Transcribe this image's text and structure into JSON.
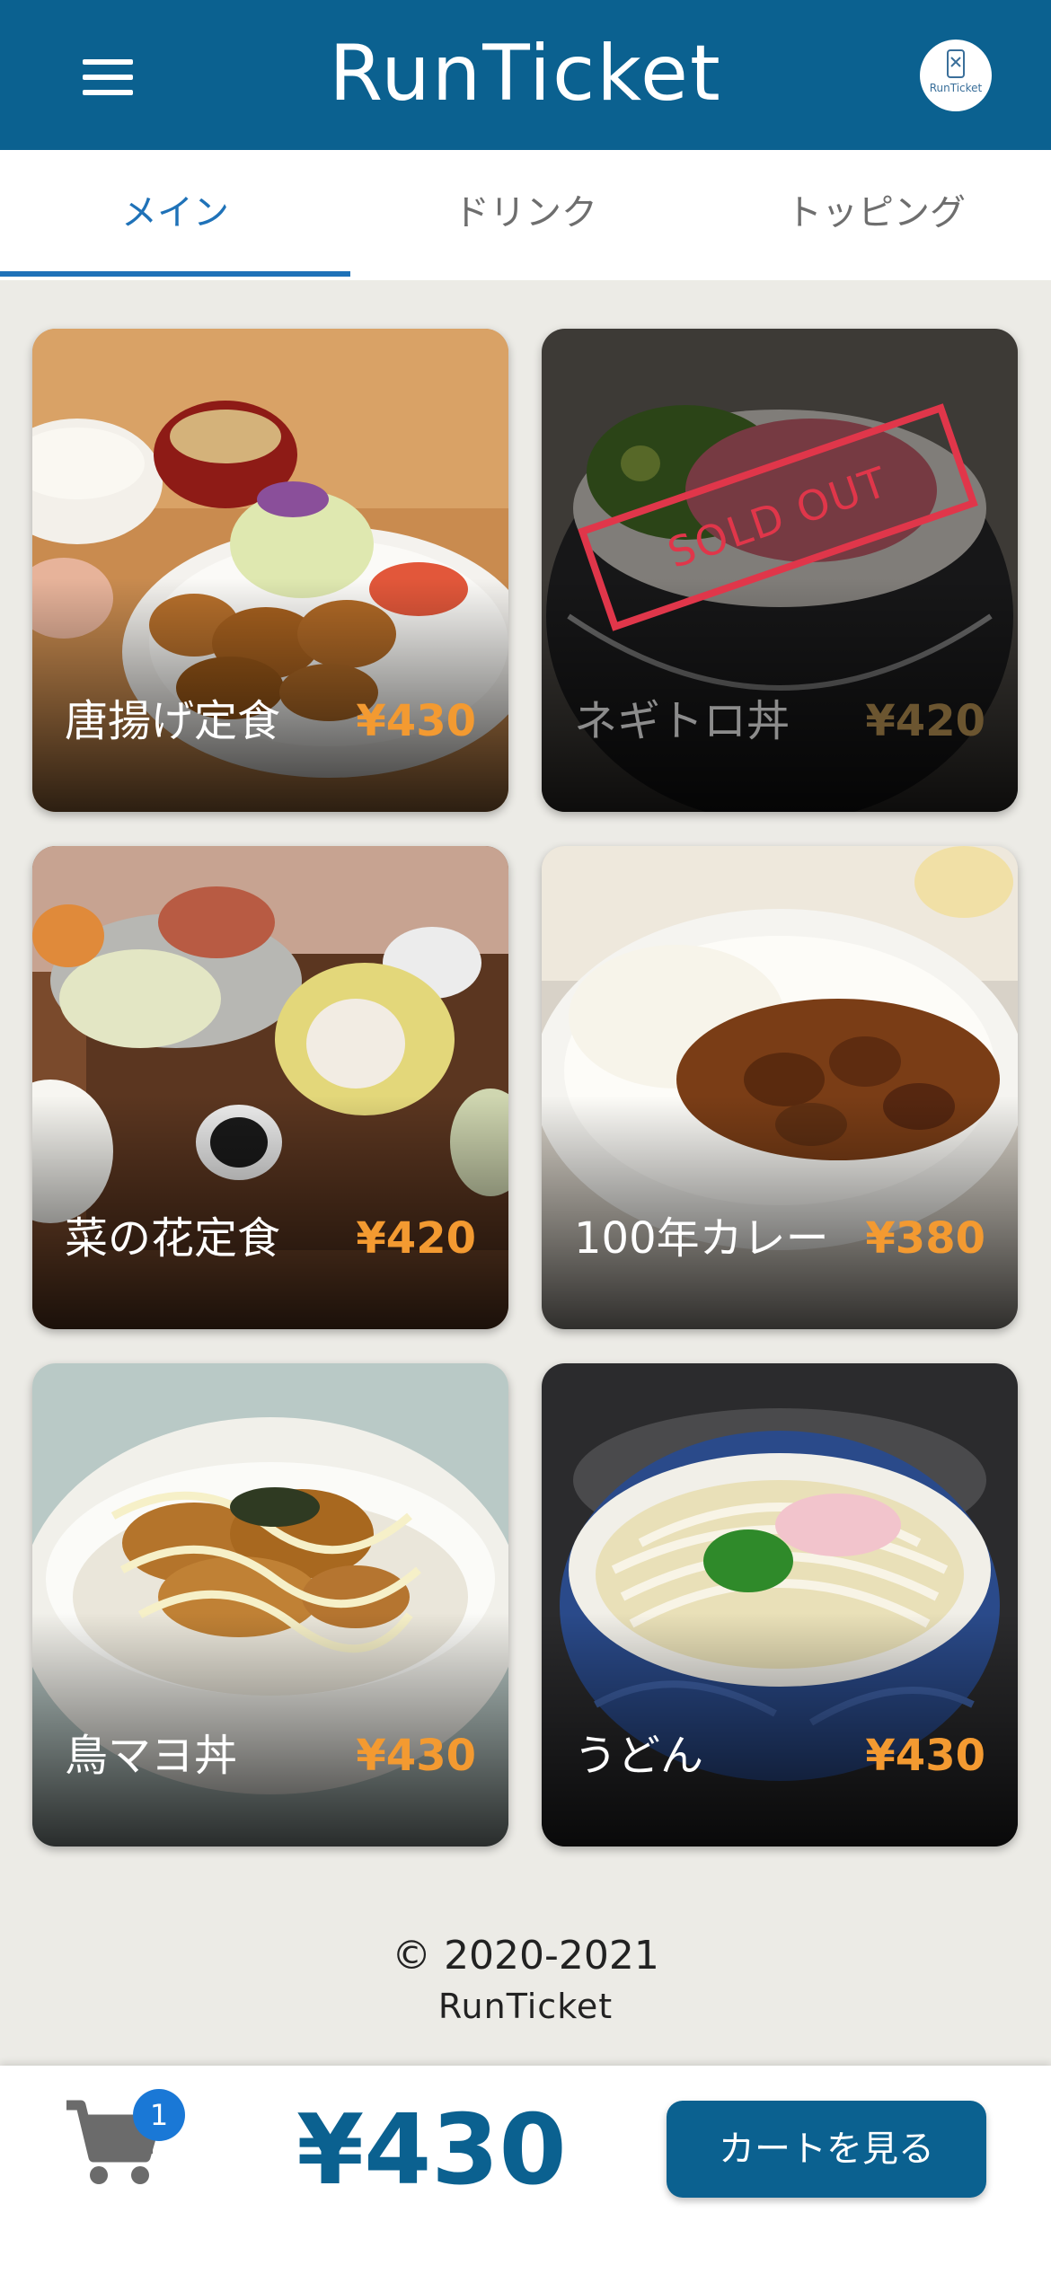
{
  "header": {
    "brand": "RunTicket",
    "avatar_text": "RunTicket"
  },
  "tabs": [
    {
      "label": "メイン",
      "active": true
    },
    {
      "label": "ドリンク",
      "active": false
    },
    {
      "label": "トッピング",
      "active": false
    }
  ],
  "menu": [
    {
      "name": "唐揚げ定食",
      "price": "¥430",
      "sold_out": false
    },
    {
      "name": "ネギトロ丼",
      "price": "¥420",
      "sold_out": true,
      "badge": "SOLD OUT"
    },
    {
      "name": "菜の花定食",
      "price": "¥420",
      "sold_out": false
    },
    {
      "name": "100年カレー",
      "price": "¥380",
      "sold_out": false
    },
    {
      "name": "鳥マヨ丼",
      "price": "¥430",
      "sold_out": false
    },
    {
      "name": "うどん",
      "price": "¥430",
      "sold_out": false
    }
  ],
  "footer": {
    "copyright": "© 2020-2021",
    "brand": "RunTicket"
  },
  "cart": {
    "count": "1",
    "total": "¥430",
    "button_label": "カートを見る"
  },
  "colors": {
    "header": "#0b6190",
    "tab_active": "#1f72b8",
    "price": "#f39a31",
    "sold_out": "#e0364a"
  }
}
